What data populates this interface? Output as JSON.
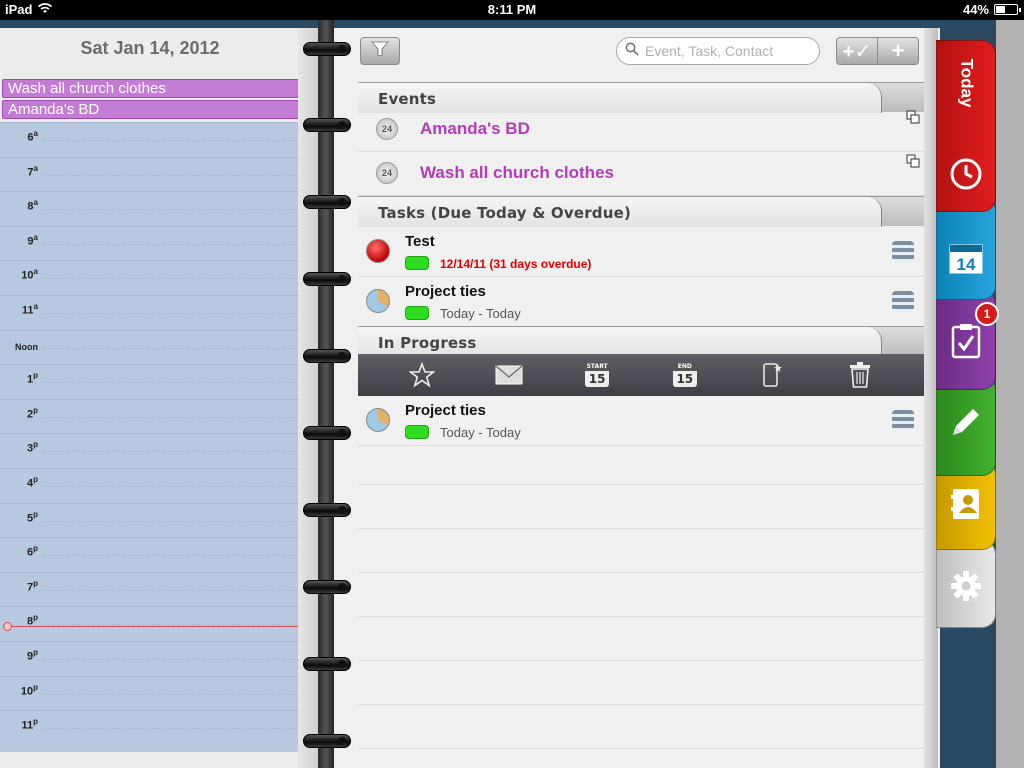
{
  "status_bar": {
    "device": "iPad",
    "time": "8:11 PM",
    "battery": "44%",
    "battery_level": 0.44
  },
  "day_view": {
    "date_title": "Sat Jan 14, 2012",
    "all_day_events": [
      "Wash all church clothes",
      "Amanda's BD"
    ],
    "hours": [
      {
        "num": "6",
        "suffix": "a"
      },
      {
        "num": "7",
        "suffix": "a"
      },
      {
        "num": "8",
        "suffix": "a"
      },
      {
        "num": "9",
        "suffix": "a"
      },
      {
        "num": "10",
        "suffix": "a"
      },
      {
        "num": "11",
        "suffix": "a"
      },
      {
        "num": "Noon",
        "suffix": ""
      },
      {
        "num": "1",
        "suffix": "p"
      },
      {
        "num": "2",
        "suffix": "p"
      },
      {
        "num": "3",
        "suffix": "p"
      },
      {
        "num": "4",
        "suffix": "p"
      },
      {
        "num": "5",
        "suffix": "p"
      },
      {
        "num": "6",
        "suffix": "p"
      },
      {
        "num": "7",
        "suffix": "p"
      },
      {
        "num": "8",
        "suffix": "p"
      },
      {
        "num": "9",
        "suffix": "p"
      },
      {
        "num": "10",
        "suffix": "p"
      },
      {
        "num": "11",
        "suffix": "p"
      }
    ]
  },
  "toolbar": {
    "search_placeholder": "Event, Task, Contact",
    "add_done_label": "+✓",
    "add_label": "+"
  },
  "sections": {
    "events_title": "Events",
    "tasks_title": "Tasks (Due Today & Overdue)",
    "in_progress_title": "In Progress"
  },
  "events": [
    {
      "clock": "24",
      "title": "Amanda's BD"
    },
    {
      "clock": "24",
      "title": "Wash all church clothes"
    }
  ],
  "tasks": [
    {
      "title": "Test",
      "due": "12/14/11 (31 days overdue)",
      "status": "red",
      "overdue": true
    },
    {
      "title": "Project ties",
      "due": "Today - Today",
      "status": "progress",
      "overdue": false
    }
  ],
  "in_progress": [
    {
      "title": "Project ties",
      "due": "Today - Today",
      "status": "progress"
    }
  ],
  "action_bar": {
    "start_label": "START",
    "start_num": "15",
    "end_label": "END",
    "end_num": "15"
  },
  "side_tabs": {
    "today_label": "Today",
    "calendar_num": "14",
    "tasks_badge": "1"
  },
  "colors": {
    "event_text": "#b43cb8",
    "overdue_text": "#e00000",
    "priority_green": "#2ede1e",
    "today_tab": "#e11d1d",
    "calendar_tab": "#26a5dc",
    "tasks_tab": "#8f41aa",
    "notes_tab": "#43b02f",
    "contacts_tab": "#f2c101"
  }
}
